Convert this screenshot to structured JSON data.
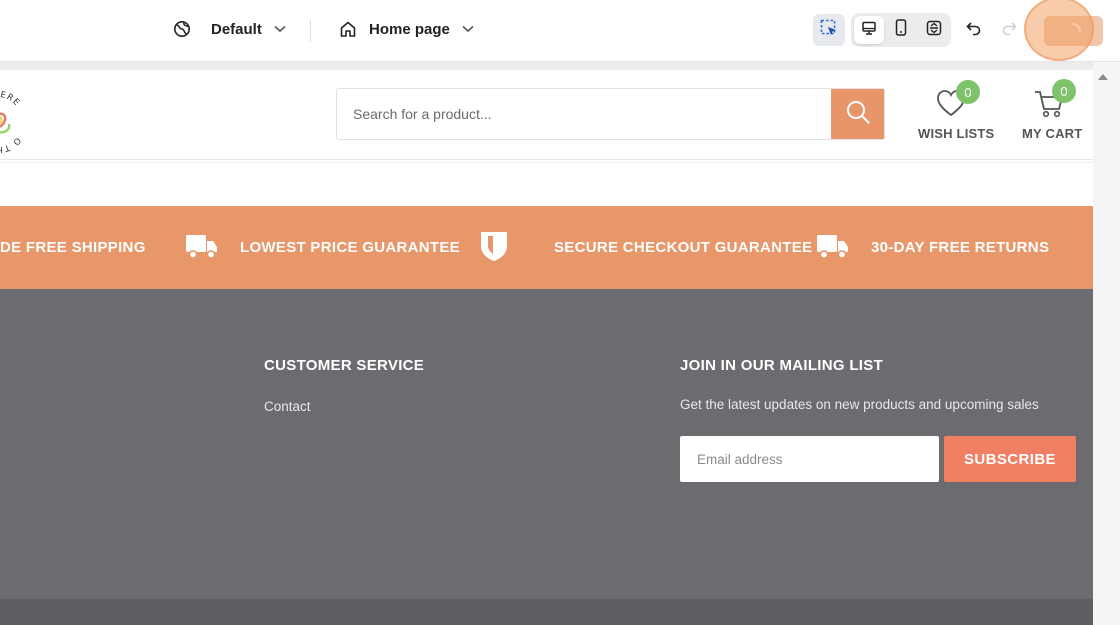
{
  "toolbar": {
    "theme_label": "Default",
    "page_label": "Home page"
  },
  "header": {
    "logo_text_top": "TA HERE",
    "logo_text_bottom": "O THERE",
    "search_placeholder": "Search for a product...",
    "wishlist": {
      "label": "WISH LISTS",
      "count": "0"
    },
    "cart": {
      "label": "MY CART",
      "count": "0"
    }
  },
  "features": [
    {
      "icon": "truck-icon",
      "label": "DE FREE SHIPPING"
    },
    {
      "icon": "truck-icon",
      "label": "LOWEST PRICE GUARANTEE"
    },
    {
      "icon": "shield-icon",
      "label": "SECURE CHECKOUT GUARANTEE"
    },
    {
      "icon": "truck-icon",
      "label": "30-DAY FREE RETURNS"
    }
  ],
  "footer": {
    "customer_service": {
      "title": "CUSTOMER SERVICE",
      "links": [
        "Contact"
      ]
    },
    "mailing": {
      "title": "JOIN IN OUR MAILING LIST",
      "description": "Get the latest updates on new products and upcoming sales",
      "email_placeholder": "Email address",
      "subscribe_label": "SUBSCRIBE"
    }
  },
  "colors": {
    "accent": "#e8976a",
    "footer_bg": "#6b6b70",
    "badge": "#7ec26a",
    "subscribe": "#f07f63"
  }
}
